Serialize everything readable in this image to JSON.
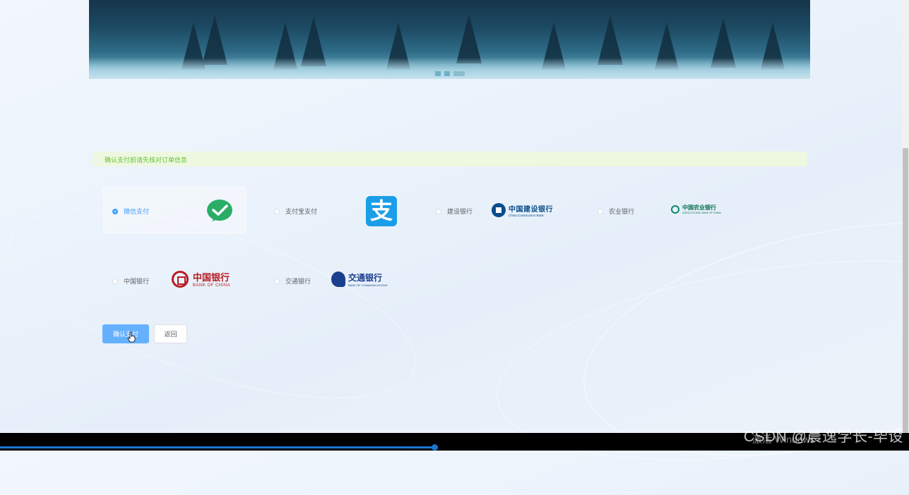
{
  "alert": {
    "text": "确认支付前请先核对订单信息"
  },
  "payment_options": [
    {
      "label": "微信支付",
      "selected": true,
      "logo": "wechat-icon"
    },
    {
      "label": "支付宝支付",
      "selected": false,
      "logo": "alipay-icon"
    },
    {
      "label": "建设银行",
      "selected": false,
      "logo": "ccb-logo"
    },
    {
      "label": "农业银行",
      "selected": false,
      "logo": "abc-logo"
    },
    {
      "label": "中国银行",
      "selected": false,
      "logo": "boc-logo"
    },
    {
      "label": "交通银行",
      "selected": false,
      "logo": "bocom-logo"
    }
  ],
  "logos": {
    "alipay_char": "支",
    "ccb_cn": "中国建设银行",
    "ccb_en": "China Construction Bank",
    "abc_cn": "中国农业银行",
    "abc_en": "AGRICULTURAL BANK OF CHINA",
    "boc_cn": "中国银行",
    "boc_en": "BANK OF CHINA",
    "bocom_cn": "交通银行",
    "bocom_en": "BANK OF COMMUNICATIONS"
  },
  "buttons": {
    "confirm": "确认支付",
    "back": "返回"
  },
  "carousel": {
    "slides": 3,
    "active_index": 2
  },
  "watermark": {
    "text": "CSDN @晨逸学长-毕设",
    "activate": "激活 Windows"
  },
  "colors": {
    "primary": "#409eff",
    "success": "#67c23a",
    "wechat": "#2aae67",
    "alipay": "#1b9ee8"
  }
}
